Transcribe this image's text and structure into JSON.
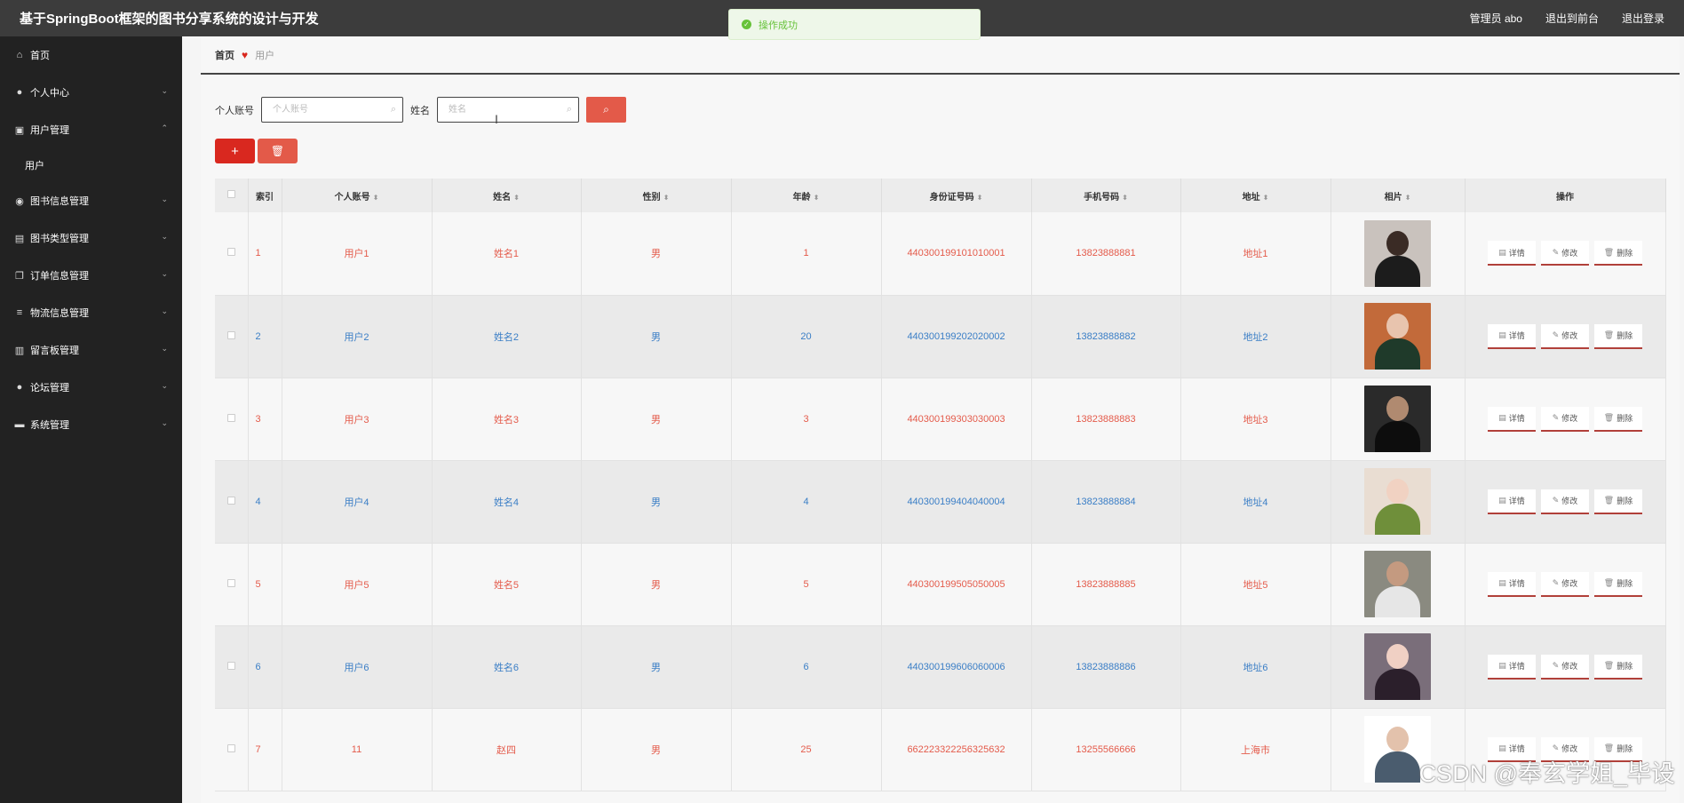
{
  "header": {
    "title": "基于SpringBoot框架的图书分享系统的设计与开发",
    "admin_label": "管理员 abo",
    "to_front": "退出到前台",
    "logout": "退出登录"
  },
  "toast": {
    "text": "操作成功"
  },
  "sidebar": {
    "items": [
      {
        "label": "首页",
        "icon": "home-icon",
        "glyph": "⌂",
        "chevron": ""
      },
      {
        "label": "个人中心",
        "icon": "user-icon",
        "glyph": "●",
        "chevron": "⌄"
      },
      {
        "label": "用户管理",
        "icon": "briefcase-icon",
        "glyph": "▣",
        "chevron": "⌃"
      },
      {
        "label": "用户",
        "sub": true
      },
      {
        "label": "图书信息管理",
        "icon": "location-icon",
        "glyph": "◉",
        "chevron": "⌄"
      },
      {
        "label": "图书类型管理",
        "icon": "doc-icon",
        "glyph": "▤",
        "chevron": "⌄"
      },
      {
        "label": "订单信息管理",
        "icon": "copy-icon",
        "glyph": "❐",
        "chevron": "⌄"
      },
      {
        "label": "物流信息管理",
        "icon": "list-icon",
        "glyph": "≡",
        "chevron": "⌄"
      },
      {
        "label": "留言板管理",
        "icon": "clipboard-icon",
        "glyph": "▥",
        "chevron": "⌄"
      },
      {
        "label": "论坛管理",
        "icon": "user-icon",
        "glyph": "●",
        "chevron": "⌄"
      },
      {
        "label": "系统管理",
        "icon": "monitor-icon",
        "glyph": "▬",
        "chevron": "⌄"
      }
    ]
  },
  "breadcrumb": {
    "home": "首页",
    "current": "用户"
  },
  "search": {
    "account_label": "个人账号",
    "account_placeholder": "个人账号",
    "name_label": "姓名",
    "name_placeholder": "姓名"
  },
  "table": {
    "headers": [
      "索引",
      "个人账号",
      "姓名",
      "性别",
      "年龄",
      "身份证号码",
      "手机号码",
      "地址",
      "相片",
      "操作"
    ],
    "ops": {
      "detail": "详情",
      "edit": "修改",
      "delete": "删除"
    },
    "rows": [
      {
        "idx": "1",
        "account": "用户1",
        "name": "姓名1",
        "gender": "男",
        "age": "1",
        "idcard": "440300199101010001",
        "phone": "13823888881",
        "address": "地址1",
        "photo_bg": "#c9c2bd",
        "photo_fg": "#1c1c1c",
        "photo_head": "#3a2b25"
      },
      {
        "idx": "2",
        "account": "用户2",
        "name": "姓名2",
        "gender": "男",
        "age": "20",
        "idcard": "440300199202020002",
        "phone": "13823888882",
        "address": "地址2",
        "photo_bg": "#c26a3a",
        "photo_fg": "#1f3a2a",
        "photo_head": "#e8c4ae"
      },
      {
        "idx": "3",
        "account": "用户3",
        "name": "姓名3",
        "gender": "男",
        "age": "3",
        "idcard": "440300199303030003",
        "phone": "13823888883",
        "address": "地址3",
        "photo_bg": "#2a2a2a",
        "photo_fg": "#0d0d0d",
        "photo_head": "#b08a70"
      },
      {
        "idx": "4",
        "account": "用户4",
        "name": "姓名4",
        "gender": "男",
        "age": "4",
        "idcard": "440300199404040004",
        "phone": "13823888884",
        "address": "地址4",
        "photo_bg": "#e9ddd2",
        "photo_fg": "#6f8f3a",
        "photo_head": "#f1d2c2"
      },
      {
        "idx": "5",
        "account": "用户5",
        "name": "姓名5",
        "gender": "男",
        "age": "5",
        "idcard": "440300199505050005",
        "phone": "13823888885",
        "address": "地址5",
        "photo_bg": "#8a8a80",
        "photo_fg": "#e6e6e6",
        "photo_head": "#c49a80"
      },
      {
        "idx": "6",
        "account": "用户6",
        "name": "姓名6",
        "gender": "男",
        "age": "6",
        "idcard": "440300199606060006",
        "phone": "13823888886",
        "address": "地址6",
        "photo_bg": "#7a6e7a",
        "photo_fg": "#2b1f2b",
        "photo_head": "#f0d0c4"
      },
      {
        "idx": "7",
        "account": "11",
        "name": "赵四",
        "gender": "男",
        "age": "25",
        "idcard": "662223322256325632",
        "phone": "13255566666",
        "address": "上海市",
        "photo_bg": "#ffffff",
        "photo_fg": "#4a5c6e",
        "photo_head": "#e3c2ac"
      }
    ]
  },
  "watermark": "CSDN @奉玄学姐_毕设"
}
